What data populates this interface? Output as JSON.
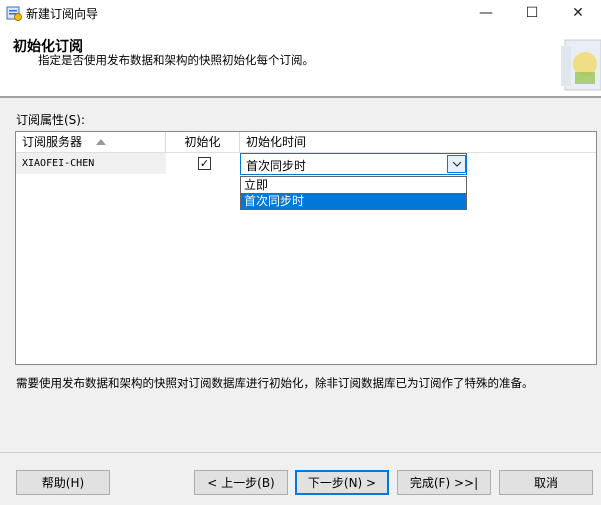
{
  "window": {
    "title": "新建订阅向导",
    "minimize": "—",
    "maximize": "☐",
    "close": "✕"
  },
  "header": {
    "title": "初始化订阅",
    "subtitle": "指定是否使用发布数据和架构的快照初始化每个订阅。"
  },
  "grid": {
    "label": "订阅属性(S):",
    "columns": [
      "订阅服务器",
      "初始化",
      "初始化时间"
    ],
    "rows": [
      {
        "server": "XIAOFEI-CHEN",
        "initialize": true,
        "time": "首次同步时"
      }
    ],
    "dropdown_options": [
      "立即",
      "首次同步时"
    ],
    "selected_option": "首次同步时"
  },
  "description": "需要使用发布数据和架构的快照对订阅数据库进行初始化，除非订阅数据库已为订阅作了特殊的准备。",
  "buttons": {
    "help": "帮助(H)",
    "back": "< 上一步(B)",
    "next": "下一步(N) >",
    "finish": "完成(F) >>|",
    "cancel": "取消"
  }
}
